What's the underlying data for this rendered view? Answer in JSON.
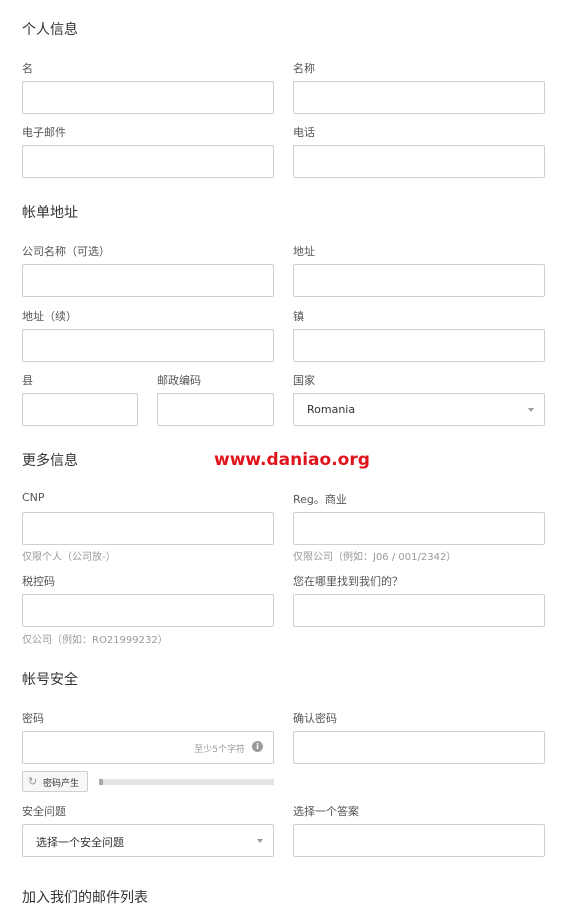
{
  "sections": {
    "personal": "个人信息",
    "billing": "帐单地址",
    "more": "更多信息",
    "security": "帐号安全",
    "mailing": "加入我们的邮件列表"
  },
  "fields": {
    "first_name": "名",
    "last_name": "名称",
    "email": "电子邮件",
    "phone": "电话",
    "company": "公司名称（可选）",
    "address1": "地址",
    "address2": "地址（续）",
    "city": "镇",
    "county": "县",
    "postcode": "邮政编码",
    "country": "国家",
    "cnp": "CNP",
    "reg": "Reg。商业",
    "tax": "税控码",
    "source": "您在哪里找到我们的？",
    "password": "密码",
    "confirm_password": "确认密码",
    "security_question": "安全问题",
    "answer": "选择一个答案"
  },
  "hints": {
    "cnp": "仅限个人（公司放-）",
    "reg": "仅限公司（例如：J06 / 001/2342）",
    "tax": "仅公司（例如：RO21999232）",
    "password_min": "至少5个字符"
  },
  "values": {
    "country": "Romania",
    "security_question": "选择一个安全问题"
  },
  "buttons": {
    "generate_password": "密码产生"
  },
  "password_strength": 0.02,
  "watermark": "www.daniao.org",
  "colors": {
    "watermark": "#e0141c",
    "border": "#cfcfcf"
  }
}
